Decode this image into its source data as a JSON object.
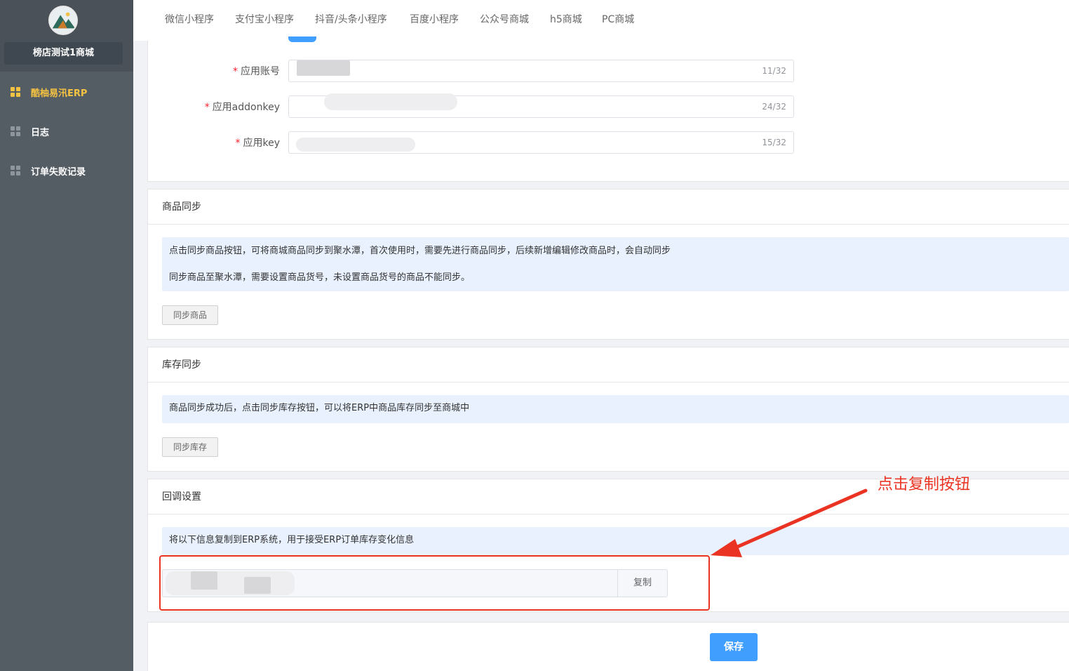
{
  "sidebar": {
    "shop_name": "榜店测试1商城",
    "items": [
      {
        "label": "酷柚易汛ERP",
        "active": true
      },
      {
        "label": "日志",
        "active": false
      },
      {
        "label": "订单失败记录",
        "active": false
      }
    ]
  },
  "tabs": [
    "微信小程序",
    "支付宝小程序",
    "抖音/头条小程序",
    "百度小程序",
    "公众号商城",
    "h5商城",
    "PC商城"
  ],
  "form": {
    "account": {
      "label": "应用账号",
      "counter": "11/32"
    },
    "addonkey": {
      "label": "应用addonkey",
      "counter": "24/32"
    },
    "key": {
      "label": "应用key",
      "counter": "15/32"
    }
  },
  "goods_sync": {
    "title": "商品同步",
    "tips": [
      "点击同步商品按钮，可将商城商品同步到聚水潭，首次使用时，需要先进行商品同步，后续新增编辑修改商品时，会自动同步",
      "同步商品至聚水潭，需要设置商品货号，未设置商品货号的商品不能同步。"
    ],
    "button": "同步商品"
  },
  "stock_sync": {
    "title": "库存同步",
    "tip": "商品同步成功后，点击同步库存按钮，可以将ERP中商品库存同步至商城中",
    "button": "同步库存"
  },
  "callback": {
    "title": "回调设置",
    "tip": "将以下信息复制到ERP系统，用于接受ERP订单库存变化信息",
    "copy_button": "复制"
  },
  "annotation": "点击复制按钮",
  "save_button": "保存",
  "colors": {
    "sidebar_bg": "#545c64",
    "active": "#f5c341",
    "primary": "#409eff",
    "tip_bg": "#e8f1fd",
    "annotation": "#ea3323"
  }
}
